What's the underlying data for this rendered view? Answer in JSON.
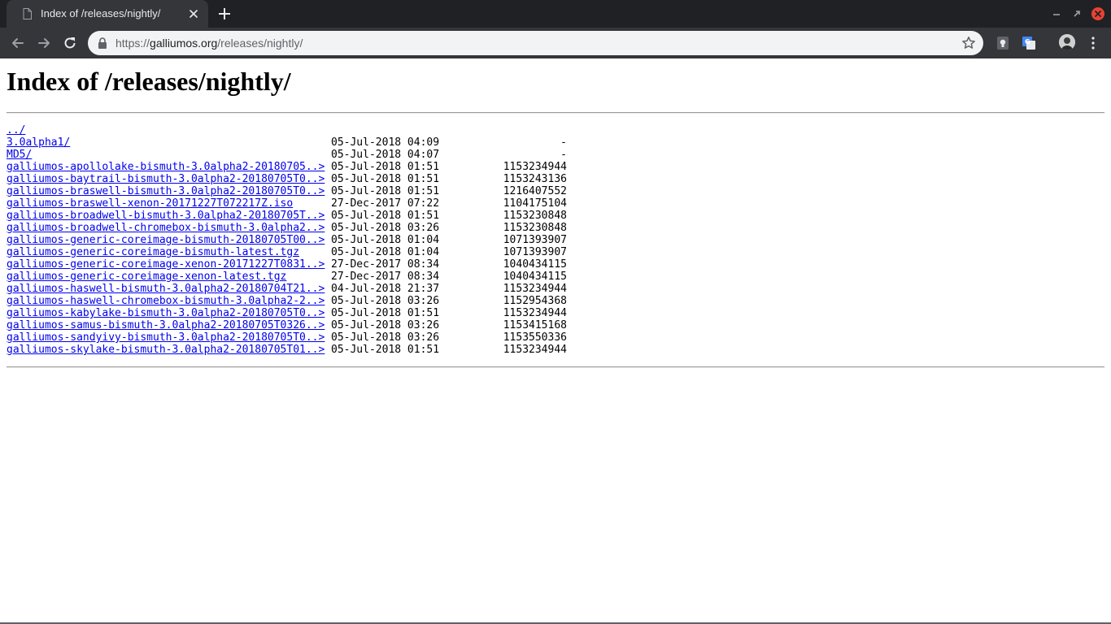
{
  "browser": {
    "tab": {
      "title": "Index of /releases/nightly/"
    },
    "address": {
      "scheme": "https://",
      "host": "galliumos.org",
      "path": "/releases/nightly/"
    }
  },
  "page": {
    "title": "Index of /releases/nightly/",
    "entries": [
      {
        "name": "../",
        "date": "",
        "size": ""
      },
      {
        "name": "3.0alpha1/",
        "date": "05-Jul-2018 04:09",
        "size": "-"
      },
      {
        "name": "MD5/",
        "date": "05-Jul-2018 04:07",
        "size": "-"
      },
      {
        "name": "galliumos-apollolake-bismuth-3.0alpha2-20180705..>",
        "date": "05-Jul-2018 01:51",
        "size": "1153234944"
      },
      {
        "name": "galliumos-baytrail-bismuth-3.0alpha2-20180705T0..>",
        "date": "05-Jul-2018 01:51",
        "size": "1153243136"
      },
      {
        "name": "galliumos-braswell-bismuth-3.0alpha2-20180705T0..>",
        "date": "05-Jul-2018 01:51",
        "size": "1216407552"
      },
      {
        "name": "galliumos-braswell-xenon-20171227T072217Z.iso",
        "date": "27-Dec-2017 07:22",
        "size": "1104175104"
      },
      {
        "name": "galliumos-broadwell-bismuth-3.0alpha2-20180705T..>",
        "date": "05-Jul-2018 01:51",
        "size": "1153230848"
      },
      {
        "name": "galliumos-broadwell-chromebox-bismuth-3.0alpha2..>",
        "date": "05-Jul-2018 03:26",
        "size": "1153230848"
      },
      {
        "name": "galliumos-generic-coreimage-bismuth-20180705T00..>",
        "date": "05-Jul-2018 01:04",
        "size": "1071393907"
      },
      {
        "name": "galliumos-generic-coreimage-bismuth-latest.tgz",
        "date": "05-Jul-2018 01:04",
        "size": "1071393907"
      },
      {
        "name": "galliumos-generic-coreimage-xenon-20171227T0831..>",
        "date": "27-Dec-2017 08:34",
        "size": "1040434115"
      },
      {
        "name": "galliumos-generic-coreimage-xenon-latest.tgz",
        "date": "27-Dec-2017 08:34",
        "size": "1040434115"
      },
      {
        "name": "galliumos-haswell-bismuth-3.0alpha2-20180704T21..>",
        "date": "04-Jul-2018 21:37",
        "size": "1153234944"
      },
      {
        "name": "galliumos-haswell-chromebox-bismuth-3.0alpha2-2..>",
        "date": "05-Jul-2018 03:26",
        "size": "1152954368"
      },
      {
        "name": "galliumos-kabylake-bismuth-3.0alpha2-20180705T0..>",
        "date": "05-Jul-2018 01:51",
        "size": "1153234944"
      },
      {
        "name": "galliumos-samus-bismuth-3.0alpha2-20180705T0326..>",
        "date": "05-Jul-2018 03:26",
        "size": "1153415168"
      },
      {
        "name": "galliumos-sandyivy-bismuth-3.0alpha2-20180705T0..>",
        "date": "05-Jul-2018 03:26",
        "size": "1153550336"
      },
      {
        "name": "galliumos-skylake-bismuth-3.0alpha2-20180705T01..>",
        "date": "05-Jul-2018 01:51",
        "size": "1153234944"
      }
    ]
  },
  "colors": {
    "tabstrip": "#202124",
    "toolbar": "#35363a",
    "omnibox": "#f1f3f4",
    "link": "#0000ee",
    "close_button": "#e94235"
  },
  "icons": {
    "tab_favicon": "document-icon",
    "tab_close": "close-icon",
    "new_tab": "plus-icon",
    "back": "arrow-left-icon",
    "forward": "arrow-right-icon",
    "reload": "reload-icon",
    "secure": "lock-icon",
    "bookmark": "star-icon",
    "extension_1": "keep-icon",
    "extension_2": "translate-icon",
    "profile": "avatar",
    "menu": "kebab-menu-icon"
  }
}
